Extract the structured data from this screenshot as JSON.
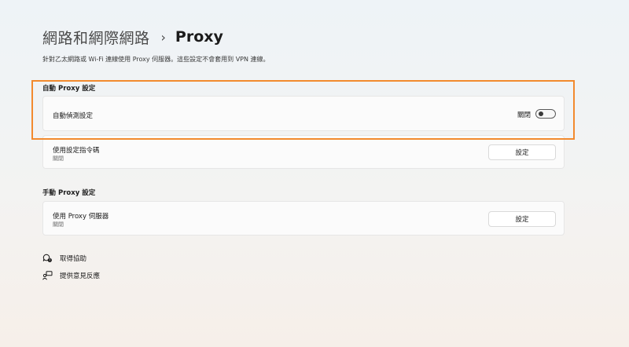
{
  "header": {
    "parent": "網路和網際網路",
    "separator": "›",
    "current": "Proxy"
  },
  "description": "針對乙太網路或 Wi-Fi 連線使用 Proxy 伺服器。這些設定不會套用到 VPN 連線。",
  "auto_proxy": {
    "title": "自動 Proxy 設定",
    "detect": {
      "label": "自動偵測設定",
      "state_label": "關閉",
      "on": false
    },
    "script": {
      "label": "使用設定指令碼",
      "status": "關閉",
      "button": "設定"
    }
  },
  "manual_proxy": {
    "title": "手動 Proxy 設定",
    "server": {
      "label": "使用 Proxy 伺服器",
      "status": "關閉",
      "button": "設定"
    }
  },
  "links": {
    "help": "取得協助",
    "feedback": "提供意見反應"
  },
  "colors": {
    "highlight": "#f28a2e"
  },
  "icons": {
    "help": "help-chat-icon",
    "feedback": "feedback-icon"
  }
}
